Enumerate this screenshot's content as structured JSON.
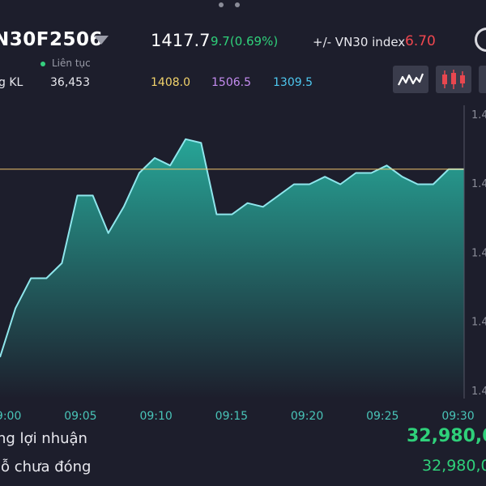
{
  "header": {
    "symbol": "N30F2506",
    "status": "Liên tục",
    "price": "1417.7",
    "change": "9.7(0.69%)",
    "index_label": "+/- VN30 index",
    "index_value": "6.70",
    "volume_label": "g KL",
    "volume_value": "36,453",
    "ref_price": "1408.0",
    "ceiling_price": "1506.5",
    "floor_price": "1309.5"
  },
  "toolbar": {
    "line_icon": "line-chart-icon",
    "candle_icon": "candlestick-icon"
  },
  "colors": {
    "background": "#1d1e2c",
    "up": "#2fd07a",
    "down": "#f0474f",
    "line": "#8fe6ec",
    "area_top": "#27a597",
    "area_bottom": "#1d1e2c",
    "reference_line": "#f2c46b"
  },
  "chart_data": {
    "type": "area",
    "x": [
      "09:00",
      "09:01",
      "09:02",
      "09:03",
      "09:04",
      "09:05",
      "09:06",
      "09:07",
      "09:08",
      "09:09",
      "09:10",
      "09:11",
      "09:12",
      "09:13",
      "09:14",
      "09:15",
      "09:16",
      "09:17",
      "09:18",
      "09:19",
      "09:20",
      "09:21",
      "09:22",
      "09:23",
      "09:24",
      "09:25",
      "09:26",
      "09:27",
      "09:28",
      "09:29",
      "09:30"
    ],
    "values": [
      1411.3,
      1412.6,
      1413.4,
      1413.4,
      1413.8,
      1415.6,
      1415.6,
      1414.6,
      1415.3,
      1416.2,
      1416.6,
      1416.4,
      1417.1,
      1417.0,
      1415.1,
      1415.1,
      1415.4,
      1415.3,
      1415.6,
      1415.9,
      1415.9,
      1416.1,
      1415.9,
      1416.2,
      1416.2,
      1416.4,
      1416.1,
      1415.9,
      1415.9,
      1416.3,
      1416.3
    ],
    "reference": 1416.3,
    "xticks": [
      "09:00",
      "09:05",
      "09:10",
      "09:15",
      "09:20",
      "09:25",
      "09:30"
    ],
    "yticks": [
      "1.4",
      "1.4",
      "1.4",
      "1.4",
      "1.4"
    ],
    "ylim": [
      1410.2,
      1418.0
    ],
    "grid": false
  },
  "summary": {
    "profit_label": "ng lợi nhuận",
    "profit_value": "32,980,0",
    "open_pl_label": "lỗ chưa đóng",
    "open_pl_value": "32,980,0"
  }
}
